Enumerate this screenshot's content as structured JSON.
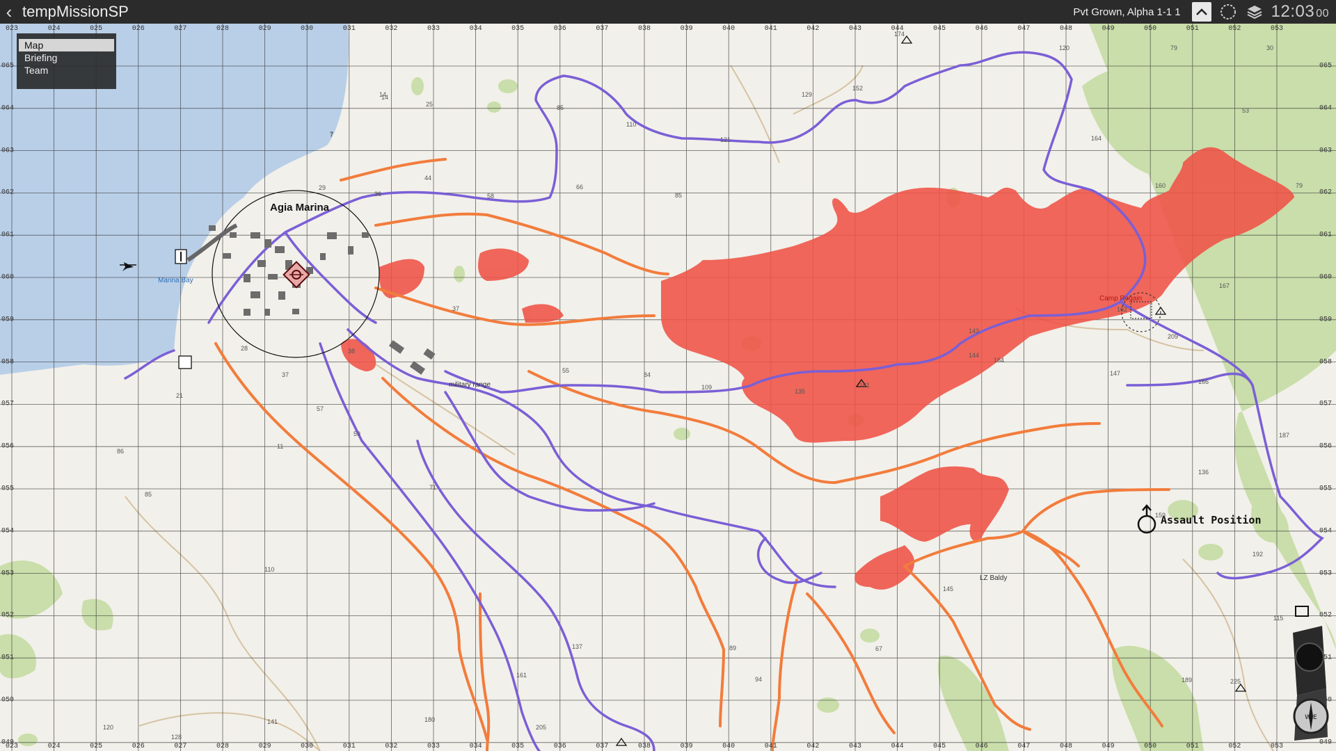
{
  "topbar": {
    "title": "tempMissionSP",
    "player": "Pvt Grown, Alpha 1-1 1",
    "clock": "12:03",
    "clock_seconds": "00",
    "icons": [
      "back-arrow-icon",
      "chevron-up-icon",
      "gps-ring-icon",
      "layers-icon"
    ]
  },
  "menu": {
    "items": [
      {
        "label": "Map",
        "active": true
      },
      {
        "label": "Briefing",
        "active": false
      },
      {
        "label": "Team",
        "active": false
      }
    ]
  },
  "grid": {
    "x_labels": [
      "023",
      "024",
      "025",
      "026",
      "027",
      "028",
      "029",
      "030",
      "031",
      "032",
      "033",
      "034",
      "035",
      "036",
      "037",
      "038",
      "039",
      "040",
      "041",
      "042",
      "043",
      "044",
      "045",
      "046",
      "047",
      "048",
      "049",
      "050",
      "051",
      "052",
      "053"
    ],
    "y_labels": [
      "065",
      "064",
      "063",
      "062",
      "061",
      "060",
      "059",
      "058",
      "057",
      "056",
      "055",
      "054",
      "053",
      "052",
      "051",
      "050",
      "049"
    ]
  },
  "places": {
    "town": "Agia Marina",
    "bay": "Marina Bay",
    "camp": "Camp Rogain",
    "range": "military range",
    "lz": "LZ Baldy",
    "assault": "Assault Position"
  },
  "elevations": [
    "174",
    "120",
    "79",
    "30",
    "53",
    "152",
    "129",
    "164",
    "160",
    "79",
    "85",
    "110",
    "121",
    "66",
    "85",
    "44",
    "58",
    "36",
    "29",
    "14",
    "25",
    "7",
    "37",
    "55",
    "84",
    "109",
    "161",
    "135",
    "164",
    "143",
    "144",
    "147",
    "166",
    "162",
    "167",
    "209",
    "187",
    "136",
    "159",
    "192",
    "145",
    "67",
    "89",
    "189",
    "225",
    "115",
    "94",
    "161",
    "137",
    "180",
    "205",
    "71",
    "59",
    "57",
    "11",
    "86",
    "85",
    "110",
    "141",
    "120",
    "128",
    "21",
    "28",
    "37",
    "38",
    "14",
    "7"
  ],
  "colors": {
    "water": "#b9cfe8",
    "land": "#f2f0ea",
    "forest": "#c9deaa",
    "blue_lines": "#7a5fd6",
    "orange_lines": "#f27c3c",
    "red_zones": "#ef5246",
    "topbar": "#2b2b2b"
  },
  "compass": {
    "label": "W E"
  }
}
